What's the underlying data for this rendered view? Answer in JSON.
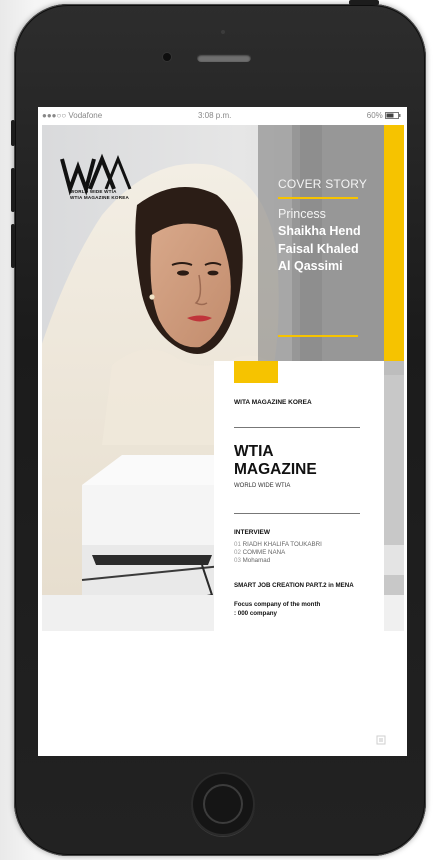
{
  "status_bar": {
    "carrier": "●●●○○ Vodafone",
    "time": "3:08 p.m.",
    "battery": "60%"
  },
  "cover": {
    "logo": {
      "text": "WA",
      "sub_line1": "WORLD WIDE WTIA",
      "sub_line2": "WTIA MAGAZINE KOREA"
    },
    "cover_story_label": "COVER STORY",
    "person_title": "Princess",
    "person_name_lines": [
      "Shaikha Hend",
      "Faisal Khaled",
      "Al Qassimi"
    ]
  },
  "info": {
    "kicker": "WITA MAGAZINE KOREA",
    "title_line1": "WTIA",
    "title_line2": "MAGAZINE",
    "subtitle": "WORLD WIDE WTIA",
    "interview_label": "INTERVIEW",
    "interview_items": [
      {
        "num": "01",
        "name": "RIADH KHALIFA TOUKABRI"
      },
      {
        "num": "02",
        "name": "COMME NANA"
      },
      {
        "num": "03",
        "name": "Mohamad"
      }
    ],
    "smart_job": "SMART JOB CREATION PART.2 in MENA",
    "focus_line1": "Focus company of the month",
    "focus_line2": ": 000 company"
  },
  "colors": {
    "accent_yellow": "#f6c300",
    "phone_body": "#222222",
    "overlay_gray": "#7a7a7a"
  }
}
